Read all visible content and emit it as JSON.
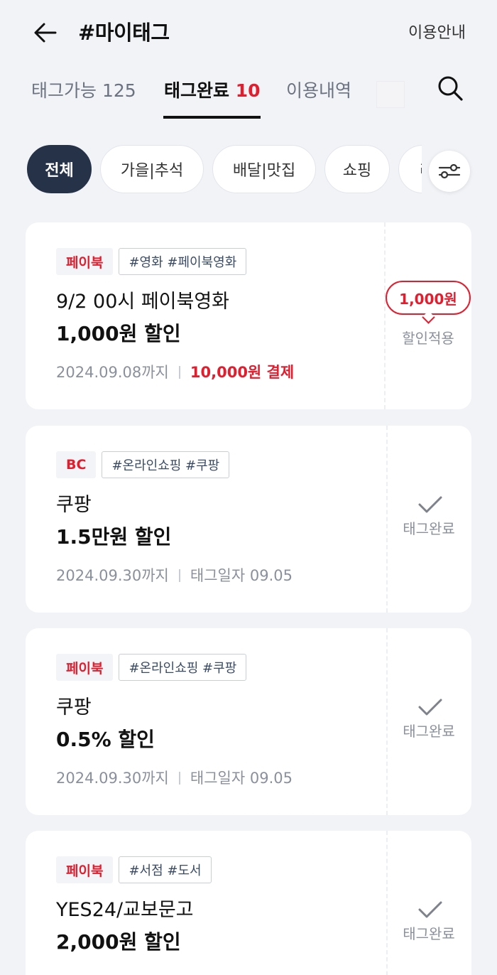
{
  "header": {
    "title": "#마이태그",
    "guide_label": "이용안내"
  },
  "tabs": [
    {
      "label": "태그가능",
      "count": "125"
    },
    {
      "label": "태그완료",
      "count": "10"
    },
    {
      "label": "이용내역",
      "count": ""
    }
  ],
  "active_tab": "태그완료",
  "chips": [
    {
      "label": "전체"
    },
    {
      "label": "가을|추석"
    },
    {
      "label": "배달|맛집"
    },
    {
      "label": "쇼핑"
    },
    {
      "label": "리"
    }
  ],
  "cards": [
    {
      "brand": "페이북",
      "tags": "#영화 #페이북영화",
      "merchant": "9/2 00시 페이북영화",
      "benefit": "1,000원 할인",
      "expiry": "2024.09.08까지",
      "condition": "10,000원 결제",
      "right_amount": "1,000원",
      "right_label": "할인적용"
    },
    {
      "brand": "BC",
      "tags": "#온라인쇼핑 #쿠팡",
      "merchant": "쿠팡",
      "benefit": "1.5만원 할인",
      "expiry": "2024.09.30까지",
      "condition": "태그일자 09.05",
      "right_label": "태그완료"
    },
    {
      "brand": "페이북",
      "tags": "#온라인쇼핑 #쿠팡",
      "merchant": "쿠팡",
      "benefit": "0.5% 할인",
      "expiry": "2024.09.30까지",
      "condition": "태그일자 09.05",
      "right_label": "태그완료"
    },
    {
      "brand": "페이북",
      "tags": "#서점 #도서",
      "merchant": "YES24/교보문고",
      "benefit": "2,000원 할인",
      "right_label": "태그완료"
    }
  ],
  "icons": {
    "back": "arrow-left-icon",
    "search": "search-icon",
    "filter": "sliders-icon",
    "check": "check-icon"
  },
  "colors": {
    "accent_red": "#e11d2e",
    "chip_active": "#253248",
    "background": "#f2f3f7"
  }
}
